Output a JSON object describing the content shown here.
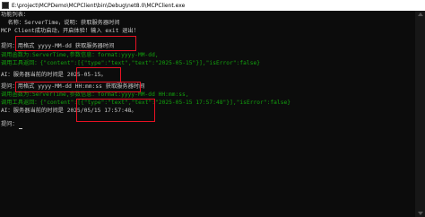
{
  "window": {
    "title": "E:\\project\\MCPDemo\\MCPClient\\bin\\Debug\\net8.0\\MCPClient.exe"
  },
  "console": {
    "lines": [
      "功能列表：",
      "  名称：ServerTime，说明：获取服务器时间",
      "MCP Client成功启动，开启体验！输入 exit 退出！",
      "",
      "提问：用格式 yyyy-MM-dd 获取服务器时间",
      "调用函数为:ServerTime,参数信息：format:yyyy-MM-dd,",
      "调用工具返回：{\"content\":[{\"type\":\"text\",\"text\":\"2025-05-15\"}],\"isError\":false}",
      "",
      "AI：服务器当前的时间是 2025-05-15。",
      "提问：用格式 yyyy-MM-dd HH:mm:ss 获取服务器时间",
      "调用函数为:ServerTime,参数信息：format:yyyy-MM-dd HH:mm:ss,",
      "调用工具返回：{\"content\":[{\"type\":\"text\",\"text\":\"2025-05-15 17:57:48\"}],\"isError\":false}",
      "",
      "AI：服务器当前的时间是 2025/05/15 17:57:48。",
      "",
      "提问："
    ]
  },
  "colors": {
    "background": "#0c0c0c",
    "text": "#cccccc",
    "green": "#13a10e",
    "highlight": "#e81123"
  }
}
